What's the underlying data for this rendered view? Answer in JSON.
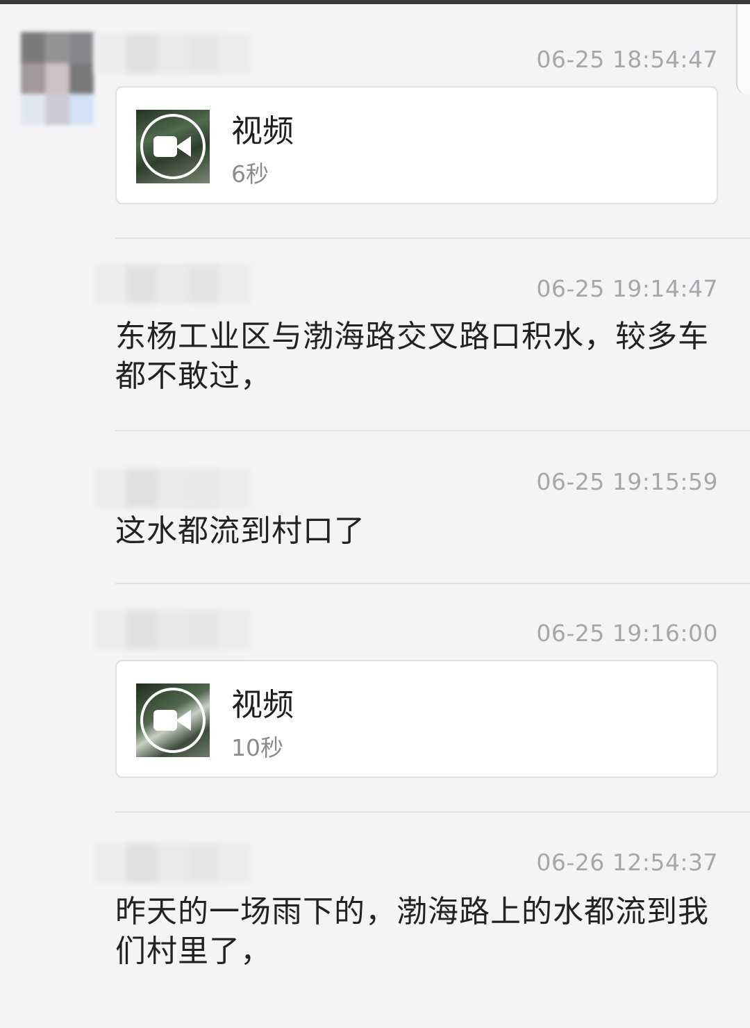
{
  "colors": {
    "background": "#f4f4f6",
    "card_background": "#ffffff",
    "timestamp": "#a7a7ab",
    "text": "#222222"
  },
  "messages": [
    {
      "timestamp": "06-25 18:54:47",
      "type": "video",
      "video": {
        "title": "视频",
        "duration": "6秒",
        "icon": "video-camera-icon"
      }
    },
    {
      "timestamp": "06-25 19:14:47",
      "type": "text",
      "text": "东杨工业区与渤海路交叉路口积水，较多车都不敢过，"
    },
    {
      "timestamp": "06-25 19:15:59",
      "type": "text",
      "text": "这水都流到村口了"
    },
    {
      "timestamp": "06-25 19:16:00",
      "type": "video",
      "video": {
        "title": "视频",
        "duration": "10秒",
        "icon": "video-camera-icon"
      }
    },
    {
      "timestamp": "06-26 12:54:37",
      "type": "text",
      "text": "昨天的一场雨下的，渤海路上的水都流到我们村里了，"
    }
  ]
}
